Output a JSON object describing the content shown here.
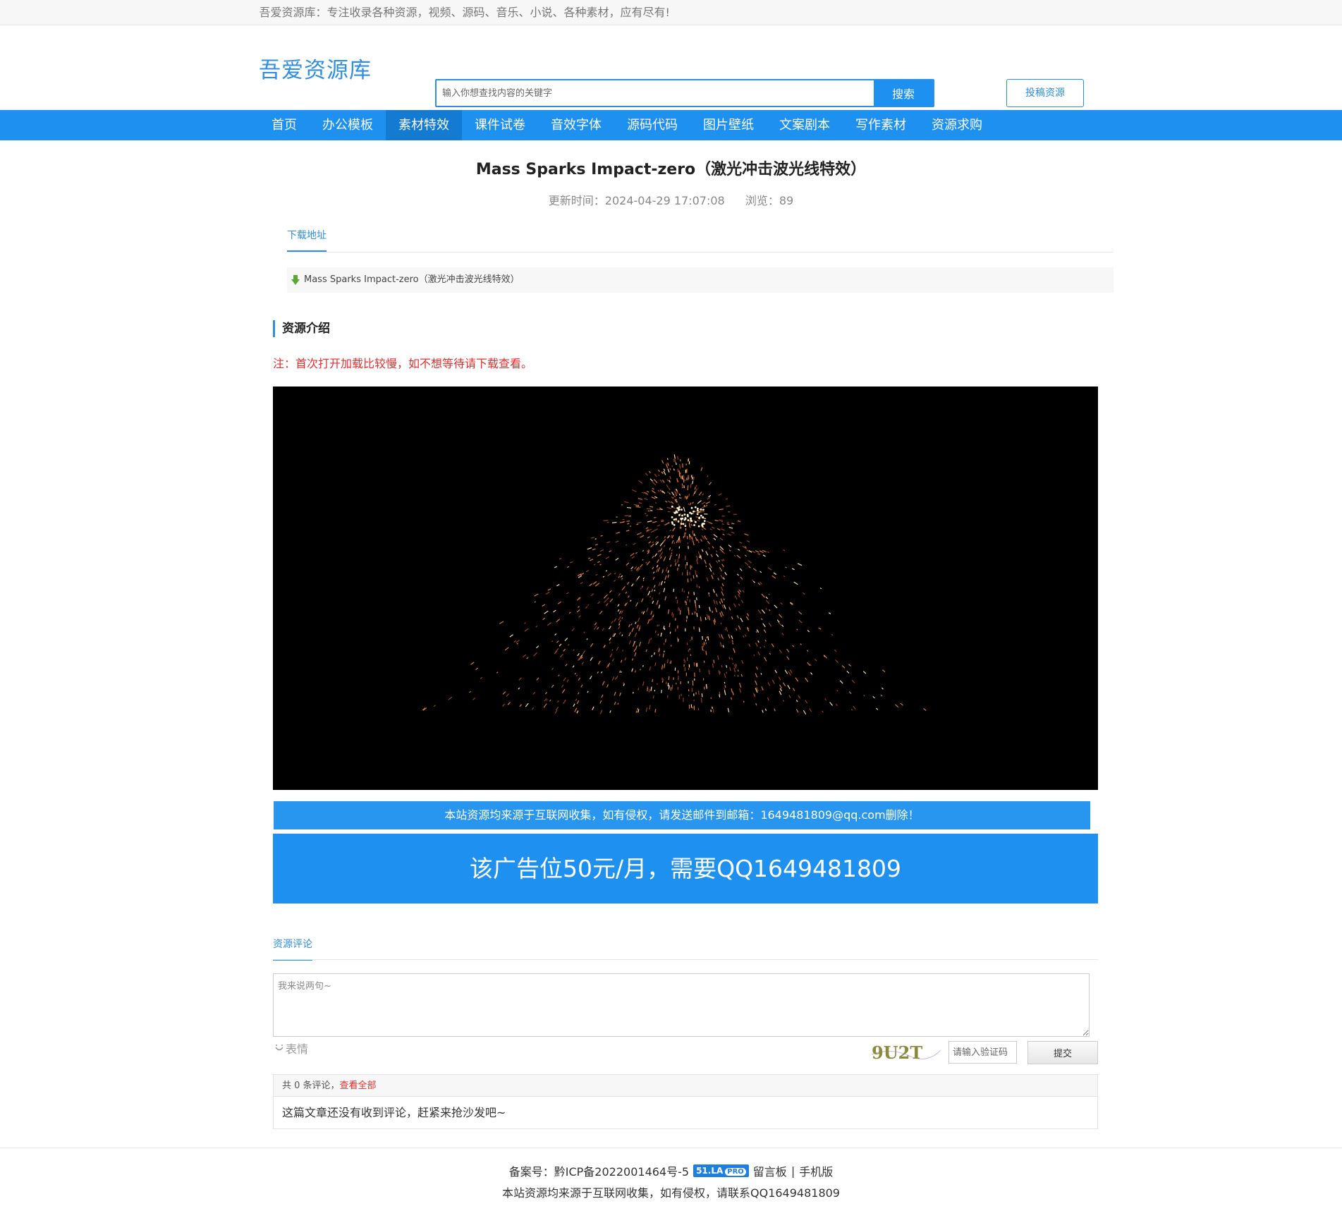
{
  "topbar": {
    "slogan": "吾爱资源库：专注收录各种资源，视频、源码、音乐、小说、各种素材，应有尽有!"
  },
  "header": {
    "logo": "吾爱资源库",
    "search_placeholder": "输入你想查找内容的关键字",
    "search_button": "搜索",
    "submit_button": "投稿资源"
  },
  "nav": {
    "items": [
      "首页",
      "办公模板",
      "素材特效",
      "课件试卷",
      "音效字体",
      "源码代码",
      "图片壁纸",
      "文案剧本",
      "写作素材",
      "资源求购"
    ],
    "active": "素材特效"
  },
  "article": {
    "title": "Mass Sparks Impact-zero（激光冲击波光线特效）",
    "updated": "更新时间：2024-04-29 17:07:08",
    "views": "浏览：89",
    "download_tab": "下载地址",
    "download_link": "Mass Sparks Impact-zero（激光冲击波光线特效）",
    "intro_heading": "资源介绍",
    "note": "注：首次打开加载比较慢，如不想等待请下载查看。",
    "notice": "本站资源均来源于互联网收集，如有侵权，请发送邮件到邮箱：1649481809@qq.com删除！",
    "ad": "该广告位50元/月，需要QQ1649481809"
  },
  "comments": {
    "tab": "资源评论",
    "placeholder": "我来说两句~",
    "emoji_label": "表情",
    "captcha_text": "9U2T",
    "captcha_placeholder": "请输入验证码",
    "submit": "提交",
    "count_prefix": "共 0 条评论，",
    "view_all": "查看全部",
    "empty": "这篇文章还没有收到评论，赶紧来抢沙发吧~"
  },
  "footer": {
    "icp": "备案号：黔ICP备2022001464号-5",
    "badge": "51.LA",
    "badge_pro": "PRO",
    "guestbook": "留言板",
    "separator": "|",
    "mobile": "手机版",
    "disclaimer": "本站资源均来源于互联网收集，如有侵权，请联系QQ1649481809"
  },
  "colors": {
    "accent": "#1e90f0",
    "nav_active": "#137bd1",
    "warning": "#e62e2e"
  }
}
